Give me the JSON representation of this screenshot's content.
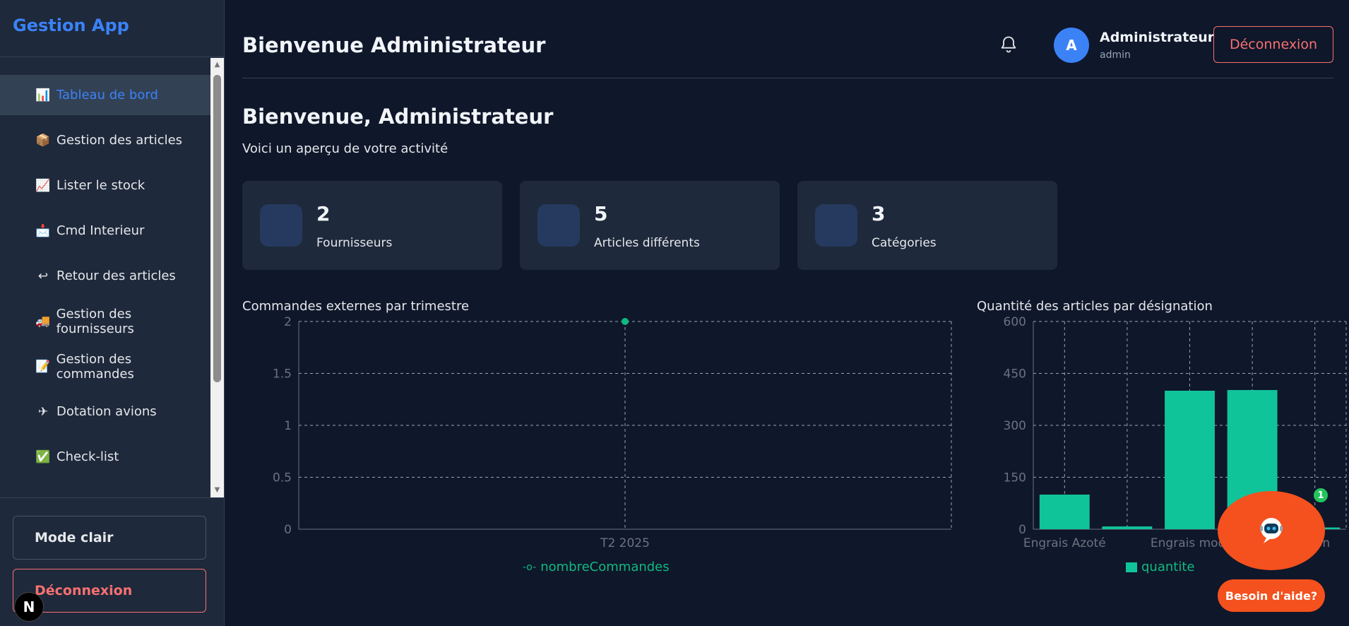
{
  "app": {
    "brand": "Gestion App"
  },
  "sidebar": {
    "items": [
      {
        "icon": "📊",
        "label": "Tableau de bord",
        "active": true
      },
      {
        "icon": "📦",
        "label": "Gestion des articles"
      },
      {
        "icon": "📈",
        "label": "Lister le stock"
      },
      {
        "icon": "📩",
        "label": "Cmd Interieur"
      },
      {
        "icon": "↩",
        "label": "Retour des articles"
      },
      {
        "icon": "🚚",
        "label": "Gestion des fournisseurs"
      },
      {
        "icon": "📝",
        "label": "Gestion des commandes"
      },
      {
        "icon": "✈",
        "label": "Dotation avions"
      },
      {
        "icon": "✅",
        "label": "Check-list"
      }
    ],
    "mode_label": "Mode clair",
    "logout_label": "Déconnexion",
    "next_badge": "N"
  },
  "header": {
    "title": "Bienvenue Administrateur",
    "user": {
      "initial": "A",
      "name": "Administrateur",
      "role": "admin"
    },
    "logout_label": "Déconnexion"
  },
  "main": {
    "welcome": "Bienvenue, Administrateur",
    "subtitle": "Voici un aperçu de votre activité",
    "cards": [
      {
        "value": "2",
        "label": "Fournisseurs"
      },
      {
        "value": "5",
        "label": "Articles différents"
      },
      {
        "value": "3",
        "label": "Catégories"
      }
    ]
  },
  "chart_data": [
    {
      "type": "line",
      "title": "Commandes externes par trimestre",
      "categories": [
        "T2 2025"
      ],
      "series": [
        {
          "name": "nombreCommandes",
          "values": [
            2
          ]
        }
      ],
      "yticks": [
        "0",
        "0.5",
        "1",
        "1.5",
        "2"
      ],
      "ylim": [
        0,
        2
      ],
      "grid": true,
      "legend": "bottom",
      "color": "#10b981"
    },
    {
      "type": "bar",
      "title": "Quantité des articles par désignation",
      "categories": [
        "Engrais Azoté",
        "",
        "Engrais modi",
        "",
        "ation"
      ],
      "series": [
        {
          "name": "quantite",
          "values": [
            100,
            8,
            400,
            402,
            5
          ]
        }
      ],
      "yticks": [
        "0",
        "150",
        "300",
        "450",
        "600"
      ],
      "ylim": [
        0,
        600
      ],
      "grid": true,
      "legend": "bottom",
      "color": "#10c49a"
    }
  ],
  "help": {
    "badge": "1",
    "label": "Besoin d'aide?"
  }
}
